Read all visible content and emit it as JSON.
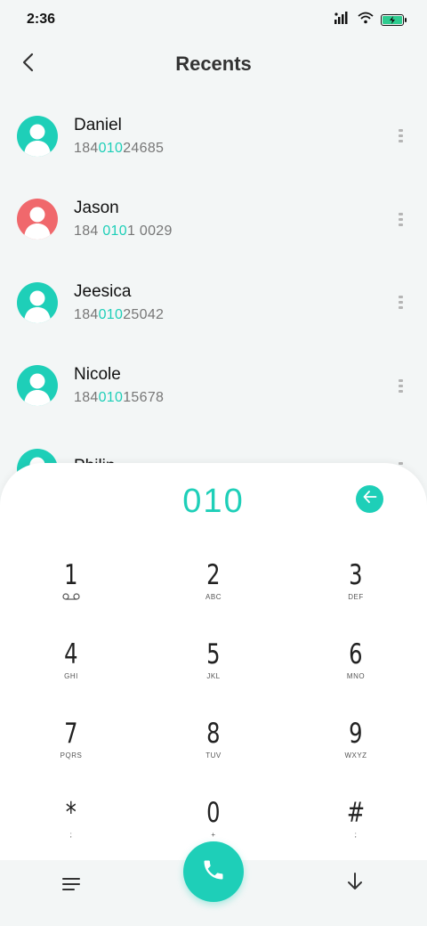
{
  "status_bar": {
    "time": "2:36",
    "icons": [
      "signal-icon",
      "wifi-icon",
      "battery-charging-icon"
    ],
    "battery_color": "#2ecb8f"
  },
  "header": {
    "title": "Recents",
    "back_icon": "chevron-left-icon"
  },
  "colors": {
    "accent": "#1ecfb8",
    "avatar_teal": "#1ecfb8",
    "avatar_red": "#f0686c"
  },
  "contacts": [
    {
      "name": "Daniel",
      "number_pre": "184",
      "number_match": "010",
      "number_post": "24685",
      "avatar_color": "#1ecfb8"
    },
    {
      "name": "Jason",
      "number_pre": "184 ",
      "number_match": "010",
      "number_post": "1 0029",
      "avatar_color": "#f0686c"
    },
    {
      "name": "Jeesica",
      "number_pre": "184",
      "number_match": "010",
      "number_post": "25042",
      "avatar_color": "#1ecfb8"
    },
    {
      "name": "Nicole",
      "number_pre": "184",
      "number_match": "010",
      "number_post": "15678",
      "avatar_color": "#1ecfb8"
    },
    {
      "name": "Philip",
      "number_pre": "",
      "number_match": "",
      "number_post": "",
      "avatar_color": "#1ecfb8"
    }
  ],
  "dialpad": {
    "display_value": "010",
    "backspace_icon": "backspace-arrow-icon",
    "keys": [
      {
        "digit": "1",
        "letters": "voicemail"
      },
      {
        "digit": "2",
        "letters": "ABC"
      },
      {
        "digit": "3",
        "letters": "DEF"
      },
      {
        "digit": "4",
        "letters": "GHI"
      },
      {
        "digit": "5",
        "letters": "JKL"
      },
      {
        "digit": "6",
        "letters": "MNO"
      },
      {
        "digit": "7",
        "letters": "PQRS"
      },
      {
        "digit": "8",
        "letters": "TUV"
      },
      {
        "digit": "9",
        "letters": "WXYZ"
      },
      {
        "digit": "*",
        "letters": ";"
      },
      {
        "digit": "0",
        "letters": "+"
      },
      {
        "digit": "#",
        "letters": ";"
      }
    ]
  },
  "bottom_bar": {
    "menu_icon": "menu-icon",
    "call_icon": "phone-icon",
    "collapse_icon": "arrow-down-icon"
  }
}
